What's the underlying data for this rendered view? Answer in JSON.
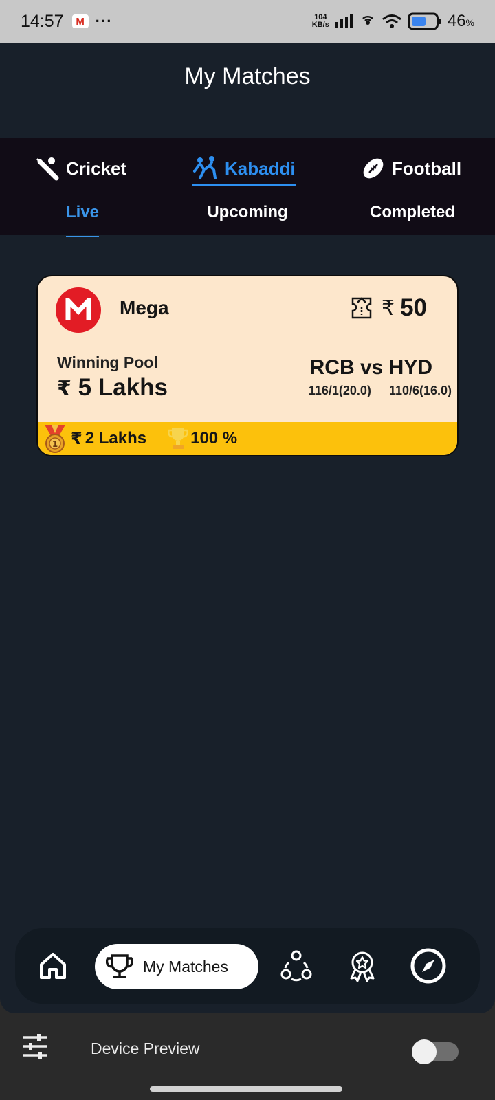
{
  "status_bar": {
    "time": "14:57",
    "gmail_glyph": "M",
    "dots": "···",
    "speed_value": "104",
    "speed_unit": "KB/s",
    "battery_percent": "46",
    "percent_sign": "%"
  },
  "page": {
    "title": "My Matches"
  },
  "sport_tabs": [
    {
      "label": "Cricket",
      "icon": "cricket-bat-icon",
      "active": false
    },
    {
      "label": "Kabaddi",
      "icon": "kabaddi-players-icon",
      "active": true
    },
    {
      "label": "Football",
      "icon": "american-football-icon",
      "active": false
    }
  ],
  "status_tabs": [
    {
      "label": "Live",
      "active": true
    },
    {
      "label": "Upcoming",
      "active": false
    },
    {
      "label": "Completed",
      "active": false
    }
  ],
  "contest_card": {
    "name": "Mega",
    "logo_letter": "M",
    "entry_currency": "₹",
    "entry_fee": "50",
    "winning_pool_label": "Winning Pool",
    "winning_pool_currency": "₹",
    "winning_pool_value": "5 Lakhs",
    "match": "RCB vs HYD",
    "team1_score": "116/1(20.0)",
    "team2_score": "110/6(16.0)",
    "first_prize_currency": "₹",
    "first_prize": "2 Lakhs",
    "win_percent": "100 %",
    "colors": {
      "card_bg": "#fde7cc",
      "footer_bg": "#fcc10c",
      "logo_bg": "#e21c25"
    }
  },
  "bottom_nav": {
    "items": [
      {
        "icon": "home-icon"
      },
      {
        "icon": "trophy-icon",
        "label": "My Matches",
        "active": true
      },
      {
        "icon": "community-icon"
      },
      {
        "icon": "award-ribbon-icon"
      },
      {
        "icon": "compass-icon"
      }
    ]
  },
  "device_preview": {
    "label": "Device Preview",
    "enabled": false
  },
  "colors": {
    "accent": "#2d8ff0",
    "app_bg": "#18202a",
    "tab_bg": "#110c16"
  }
}
